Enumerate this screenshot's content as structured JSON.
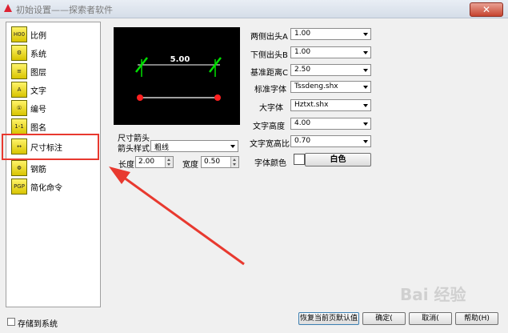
{
  "window": {
    "title": "初始设置——探索者软件",
    "close": "✕"
  },
  "sidebar": {
    "items": [
      {
        "label": "比例",
        "icon": "H00"
      },
      {
        "label": "系统",
        "icon": "⚙"
      },
      {
        "label": "图层",
        "icon": "≡"
      },
      {
        "label": "文字",
        "icon": "A"
      },
      {
        "label": "编号",
        "icon": "①"
      },
      {
        "label": "图名",
        "icon": "1-1"
      },
      {
        "label": "尺寸标注",
        "icon": "↔"
      },
      {
        "label": "钢筋",
        "icon": "Φ"
      },
      {
        "label": "简化命令",
        "icon": "PGP"
      }
    ],
    "save_checkbox": "存储到系统"
  },
  "preview": {
    "dimension_text": "5.00"
  },
  "arrow_group": {
    "title": "尺寸箭头",
    "style_label": "箭头样式",
    "style_value": "粗线",
    "length_label": "长度",
    "length_value": "2.00",
    "width_label": "宽度",
    "width_value": "0.50"
  },
  "settings": {
    "ext_a_label": "两侧出头A",
    "ext_a_value": "1.00",
    "ext_b_label": "下侧出头B",
    "ext_b_value": "1.00",
    "base_c_label": "基准距离C",
    "base_c_value": "2.50",
    "std_font_label": "标准字体",
    "std_font_value": "Tssdeng.shx",
    "big_font_label": "大字体",
    "big_font_value": "Hztxt.shx",
    "text_height_label": "文字高度",
    "text_height_value": "4.00",
    "width_ratio_label": "文字宽高比",
    "width_ratio_value": "0.70",
    "font_color_label": "字体颜色",
    "font_color_value": "白色"
  },
  "buttons": {
    "restore": "恢复当前页默认值",
    "ok": "确定(",
    "cancel": "取消(",
    "help": "帮助(H)"
  },
  "watermark": "Bai 经验",
  "colors": {
    "highlight": "#e8392f",
    "dim_line": "#00e000",
    "point": "#ff2020"
  }
}
